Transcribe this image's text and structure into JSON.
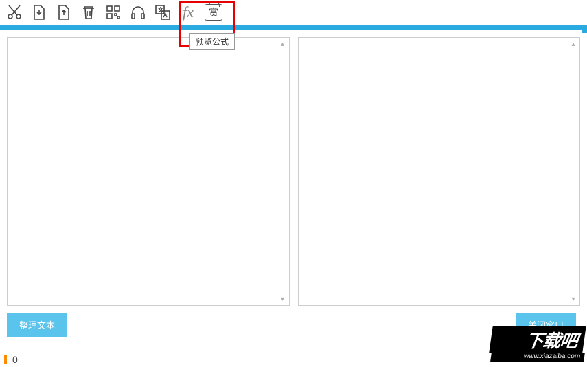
{
  "tooltip": {
    "text": "预览公式"
  },
  "toolbar": {
    "fx_label": "fx",
    "gift_label": "赏"
  },
  "buttons": {
    "organize_text": "整理文本",
    "close_window": "关闭窗口"
  },
  "status": {
    "count": "0"
  },
  "watermark": {
    "title": "下载吧",
    "url": "www.xiazaiba.com"
  },
  "icons": {
    "cut": "cut-icon",
    "import": "import-icon",
    "export": "export-icon",
    "delete": "delete-icon",
    "qr": "qr-icon",
    "headphones": "headphones-icon",
    "translate": "translate-icon"
  }
}
